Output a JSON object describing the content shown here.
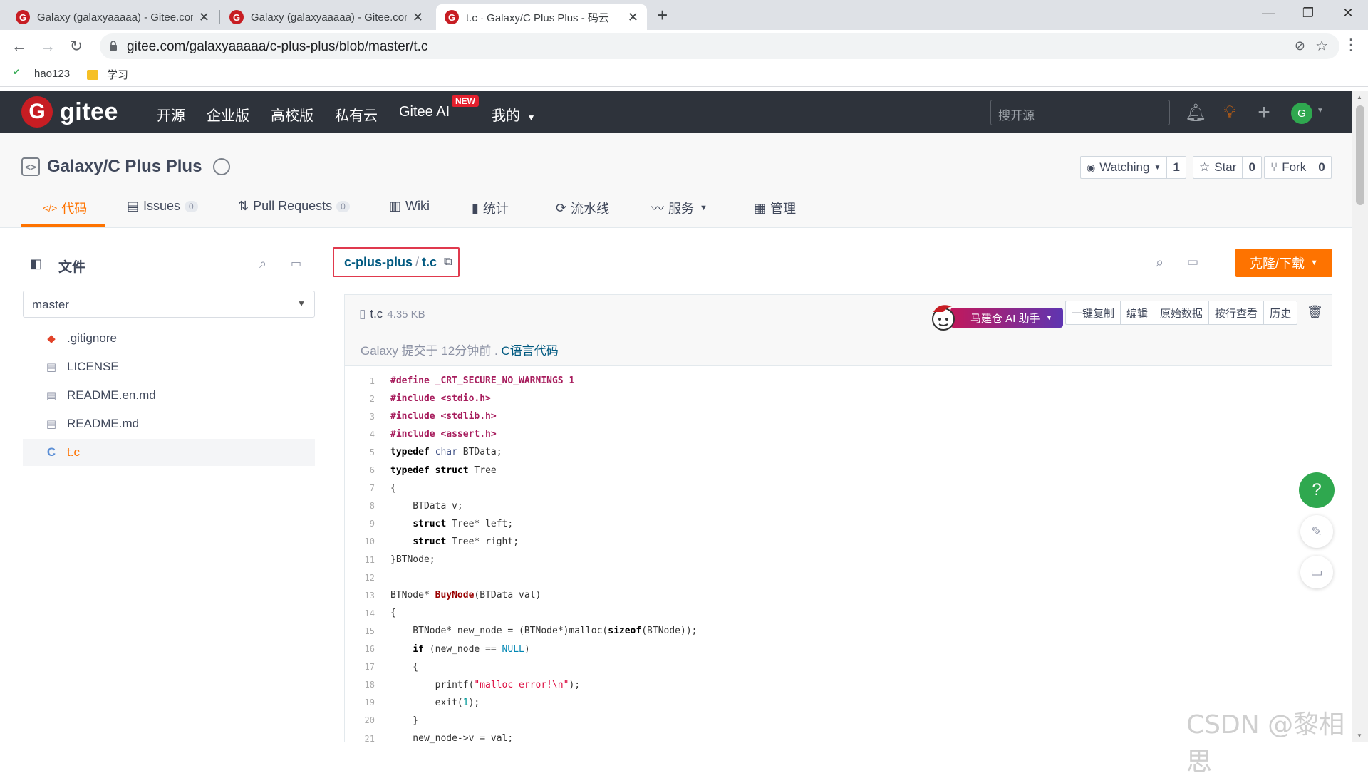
{
  "browser": {
    "tabs": [
      {
        "title": "Galaxy (galaxyaaaaa) - Gitee.com",
        "active": false
      },
      {
        "title": "Galaxy (galaxyaaaaa) - Gitee.com",
        "active": false
      },
      {
        "title": "t.c · Galaxy/C Plus Plus - 码云",
        "active": true
      }
    ],
    "url": "gitee.com/galaxyaaaaa/c-plus-plus/blob/master/t.c",
    "bookmarks": [
      "hao123",
      "学习"
    ]
  },
  "gitee_header": {
    "logo_text": "gitee",
    "logo_letter": "G",
    "nav": [
      "开源",
      "企业版",
      "高校版",
      "私有云",
      "Gitee AI",
      "我的"
    ],
    "new_badge": "NEW",
    "search_placeholder": "搜开源",
    "avatar_letter": "G"
  },
  "repo": {
    "title": "Galaxy/C Plus Plus",
    "watching_label": "Watching",
    "watching_count": "1",
    "star_label": "Star",
    "star_count": "0",
    "fork_label": "Fork",
    "fork_count": "0",
    "tabs": [
      {
        "label": "代码",
        "count": null,
        "active": true
      },
      {
        "label": "Issues",
        "count": "0"
      },
      {
        "label": "Pull Requests",
        "count": "0"
      },
      {
        "label": "Wiki",
        "count": null
      },
      {
        "label": "统计",
        "count": null
      },
      {
        "label": "流水线",
        "count": null
      },
      {
        "label": "服务",
        "count": null
      },
      {
        "label": "管理",
        "count": null
      }
    ]
  },
  "tree": {
    "title": "文件",
    "branch": "master",
    "files": [
      {
        "name": ".gitignore",
        "icon": "git-icon"
      },
      {
        "name": "LICENSE",
        "icon": "book-icon"
      },
      {
        "name": "README.en.md",
        "icon": "book-icon"
      },
      {
        "name": "README.md",
        "icon": "book-icon"
      },
      {
        "name": "t.c",
        "icon": "c-file-icon",
        "active": true
      }
    ]
  },
  "file": {
    "path_repo": "c-plus-plus",
    "path_sep": "/",
    "path_file": "t.c",
    "clone_label": "克隆/下载",
    "name": "t.c",
    "size": "4.35 KB",
    "ai_label": "马建仓 AI 助手",
    "actions": [
      "一键复制",
      "编辑",
      "原始数据",
      "按行查看",
      "历史"
    ],
    "commit_prefix": "Galaxy 提交于 12分钟前 .",
    "commit_msg": "C语言代码"
  },
  "code_lines": [
    "#define _CRT_SECURE_NO_WARNINGS 1",
    "#include <stdio.h>",
    "#include <stdlib.h>",
    "#include <assert.h>",
    "typedef char BTData;",
    "typedef struct Tree",
    "{",
    "    BTData v;",
    "    struct Tree* left;",
    "    struct Tree* right;",
    "}BTNode;",
    "",
    "BTNode* BuyNode(BTData val)",
    "{",
    "    BTNode* new_node = (BTNode*)malloc(sizeof(BTNode));",
    "    if (new_node == NULL)",
    "    {",
    "        printf(\"malloc error!\\n\");",
    "        exit(1);",
    "    }",
    "    new_node->v = val;"
  ],
  "floating": {
    "help": "?"
  },
  "watermark": "CSDN @黎相思"
}
